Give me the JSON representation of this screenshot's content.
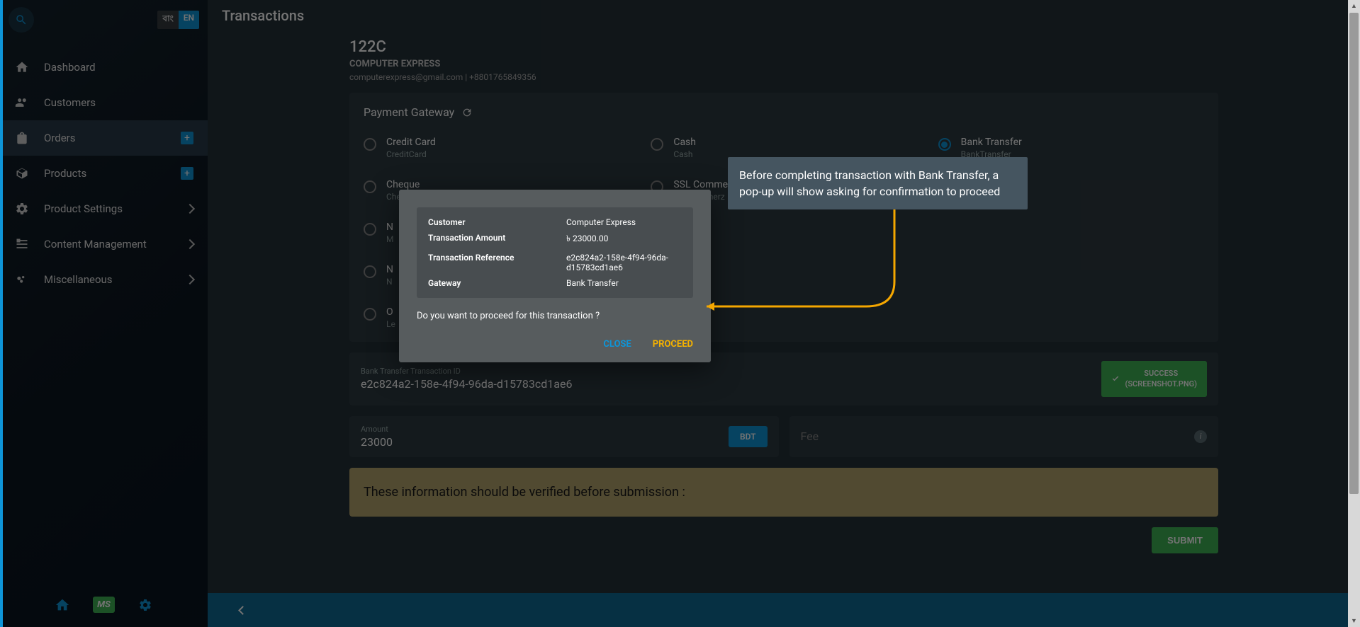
{
  "langToggle": {
    "bn": "বাং",
    "en": "EN"
  },
  "sidebar": {
    "items": [
      {
        "label": "Dashboard",
        "icon": "home"
      },
      {
        "label": "Customers",
        "icon": "users"
      },
      {
        "label": "Orders",
        "icon": "bag",
        "action": "plus",
        "active": true
      },
      {
        "label": "Products",
        "icon": "box",
        "action": "plus"
      },
      {
        "label": "Product Settings",
        "icon": "gear",
        "chevron": true
      },
      {
        "label": "Content Management",
        "icon": "content",
        "chevron": true
      },
      {
        "label": "Miscellaneous",
        "icon": "misc",
        "chevron": true
      }
    ],
    "bottom": {
      "ms": "MS"
    }
  },
  "header": {
    "title": "Transactions"
  },
  "customer": {
    "id": "122C",
    "name": "COMPUTER EXPRESS",
    "email": "computerexpress@gmail.com",
    "phone": "+8801765849356"
  },
  "gateway": {
    "title": "Payment Gateway",
    "options": [
      {
        "label": "Credit Card",
        "sub": "CreditCard"
      },
      {
        "label": "Cash",
        "sub": "Cash"
      },
      {
        "label": "Bank Transfer",
        "sub": "BankTransfer",
        "selected": true
      },
      {
        "label": "Cheque",
        "sub": "Cheque"
      },
      {
        "label": "SSL Commerz",
        "sub": "SSLCommerz"
      },
      {
        "label": "N",
        "sub": "M"
      },
      {
        "label": "N",
        "sub": "N"
      },
      {
        "label": "O",
        "sub": "Le"
      }
    ]
  },
  "bankTransfer": {
    "idLabel": "Bank Transfer Transaction ID",
    "idValue": "e2c824a2-158e-4f94-96da-d15783cd1ae6",
    "successLine1": "SUCCESS",
    "successLine2": "(SCREENSHOT.PNG)"
  },
  "amount": {
    "label": "Amount",
    "value": "23000",
    "currency": "BDT"
  },
  "fee": {
    "placeholder": "Fee"
  },
  "warning": "These information should be verified before submission :",
  "submit": "SUBMIT",
  "modal": {
    "rows": [
      {
        "key": "Customer",
        "val": "Computer Express"
      },
      {
        "key": "Transaction Amount",
        "val": "৳ 23000.00"
      },
      {
        "key": "Transaction Reference",
        "val": "e2c824a2-158e-4f94-96da-d15783cd1ae6"
      },
      {
        "key": "Gateway",
        "val": "Bank Transfer"
      }
    ],
    "question": "Do you want to proceed for this transaction ?",
    "close": "CLOSE",
    "proceed": "PROCEED"
  },
  "callout": "Before completing transaction with Bank Transfer, a pop-up will show asking for confirmation to proceed"
}
